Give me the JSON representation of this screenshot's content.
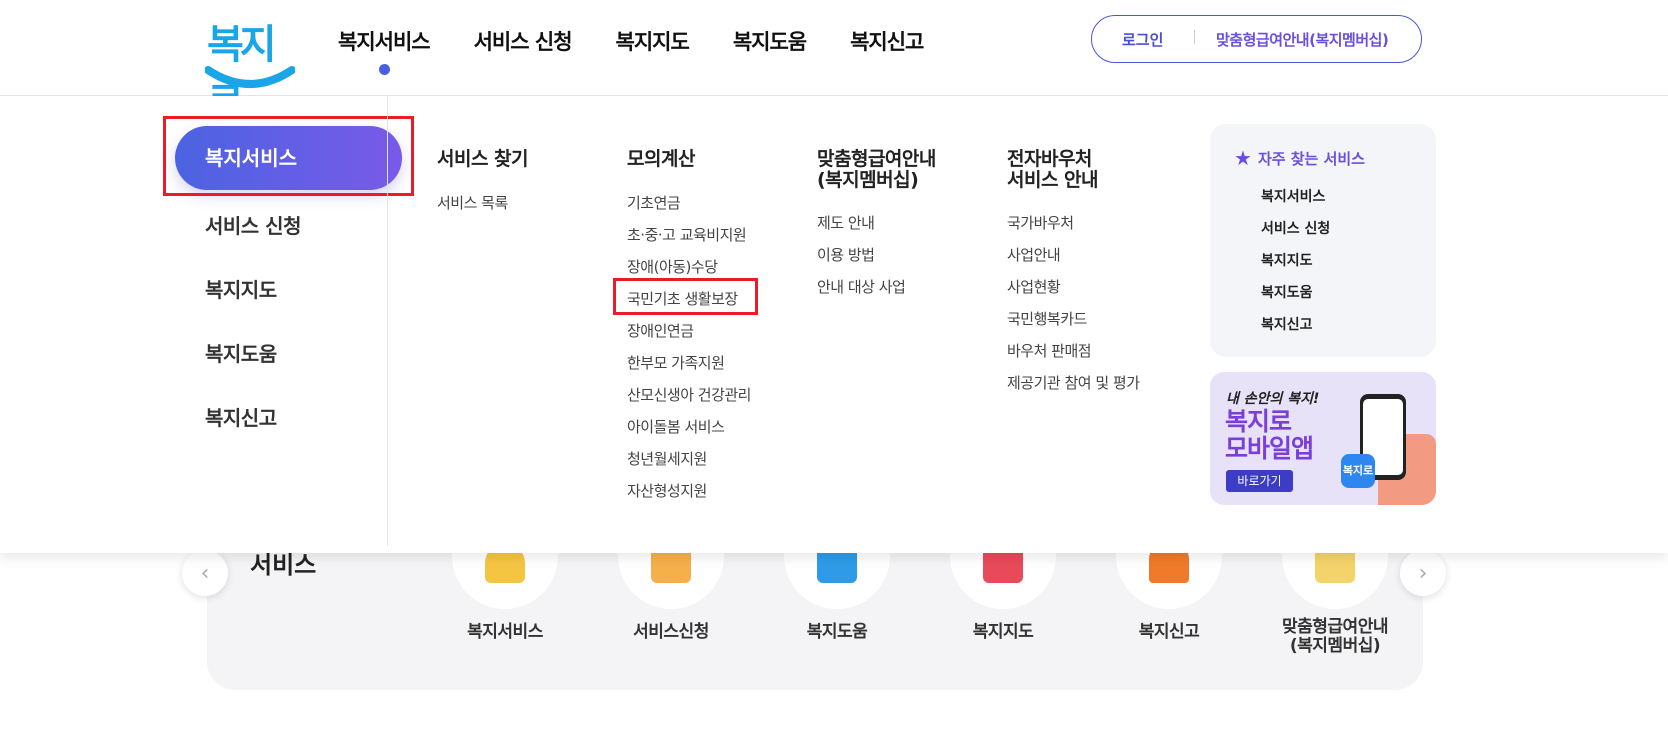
{
  "header": {
    "logo_text": "복지로",
    "nav": [
      "복지서비스",
      "서비스 신청",
      "복지지도",
      "복지도움",
      "복지신고"
    ],
    "login_label": "로그인",
    "member_label": "맞춤형급여안내(복지멤버십)"
  },
  "mega_menu": {
    "left": {
      "active": "복지서비스",
      "items": [
        "서비스 신청",
        "복지지도",
        "복지도움",
        "복지신고"
      ]
    },
    "columns": [
      {
        "heading": "서비스 찾기",
        "links": [
          "서비스 목록"
        ]
      },
      {
        "heading": "모의계산",
        "links": [
          "기초연금",
          "초·중·고 교육비지원",
          "장애(아동)수당",
          "국민기초 생활보장",
          "장애인연금",
          "한부모 가족지원",
          "산모신생아 건강관리",
          "아이돌봄 서비스",
          "청년월세지원",
          "자산형성지원"
        ]
      },
      {
        "heading": "맞춤형급여안내\n(복지멤버십)",
        "links": [
          "제도 안내",
          "이용 방법",
          "안내 대상 사업"
        ]
      },
      {
        "heading": "전자바우처\n서비스 안내",
        "links": [
          "국가바우처",
          "사업안내",
          "사업현황",
          "국민행복카드",
          "바우처 판매점",
          "제공기관 참여 및 평가"
        ]
      }
    ],
    "favorites": {
      "heading": "자주 찾는 서비스",
      "links": [
        "복지서비스",
        "서비스 신청",
        "복지지도",
        "복지도움",
        "복지신고"
      ]
    },
    "app_banner": {
      "tagline": "내 손안의 복지!",
      "title": "복지로\n모바일앱",
      "button": "바로가기",
      "icon_text": "복지로"
    }
  },
  "background_section": {
    "title": "서비스",
    "services": [
      "복지서비스",
      "서비스신청",
      "복지도움",
      "복지지도",
      "복지신고",
      "맞춤형급여안내\n(복지멤버십)"
    ],
    "service_colors": [
      "#f5c542",
      "#f6b04a",
      "#2f9be8",
      "#e84a5a",
      "#f07a2a",
      "#f3d36a"
    ]
  },
  "colors": {
    "accent": "#4a5fe0",
    "accent_purple": "#7a5ae8",
    "highlight_red": "#ec1c24"
  }
}
